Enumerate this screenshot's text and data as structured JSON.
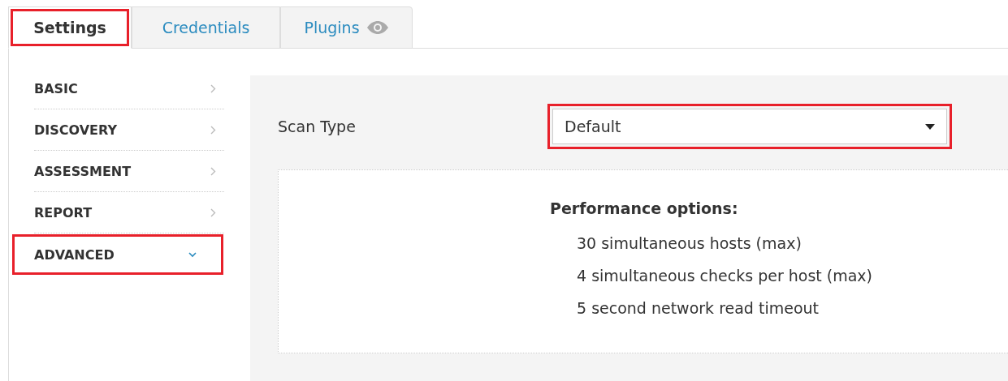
{
  "tabs": [
    {
      "label": "Settings",
      "selected": true,
      "highlighted": true,
      "kind": "plain"
    },
    {
      "label": "Credentials",
      "selected": false,
      "highlighted": false,
      "kind": "plain"
    },
    {
      "label": "Plugins",
      "selected": false,
      "highlighted": false,
      "kind": "watchable"
    }
  ],
  "sidebar": {
    "items": [
      {
        "label": "BASIC",
        "expanded": false,
        "highlighted": false
      },
      {
        "label": "DISCOVERY",
        "expanded": false,
        "highlighted": false
      },
      {
        "label": "ASSESSMENT",
        "expanded": false,
        "highlighted": false
      },
      {
        "label": "REPORT",
        "expanded": false,
        "highlighted": false
      },
      {
        "label": "ADVANCED",
        "expanded": true,
        "highlighted": true
      }
    ]
  },
  "scan_type": {
    "label": "Scan Type",
    "value": "Default",
    "highlighted": true
  },
  "info": {
    "title": "Performance options:",
    "lines": [
      "30 simultaneous hosts (max)",
      "4 simultaneous checks per host (max)",
      "5 second network read timeout"
    ]
  }
}
